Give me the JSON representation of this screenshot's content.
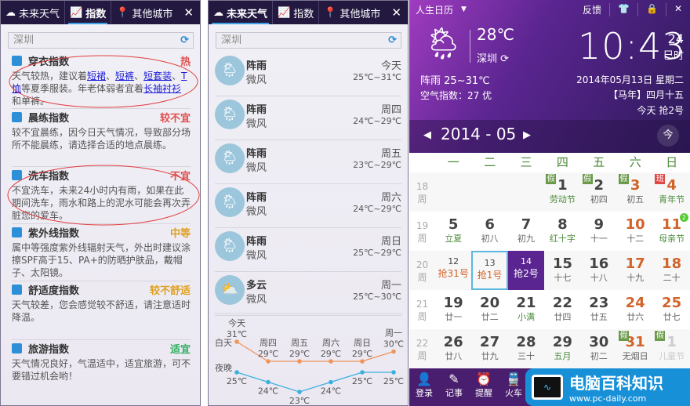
{
  "tabs": {
    "future": "未来天气",
    "index": "指数",
    "city": "其他城市"
  },
  "search": {
    "value": "深圳"
  },
  "indices": [
    {
      "title": "穿衣指数",
      "level": "热",
      "level_color": "#e05050",
      "icon": "shirt-icon",
      "desc_parts": [
        "天气较热，建议着",
        {
          "link": "短裙"
        },
        "、",
        {
          "link": "短裤"
        },
        "、",
        {
          "link": "短套装"
        },
        "、",
        {
          "link": "T恤"
        },
        "等夏季服装。年老体弱者宜着",
        {
          "link": "长袖衬衫"
        },
        "和单裤。"
      ]
    },
    {
      "title": "晨练指数",
      "level": "较不宜",
      "level_color": "#e05050",
      "icon": "exercise-icon",
      "desc": "较不宜晨练，因今日天气情况，导致部分场所不能晨练，请选择合适的地点晨练。"
    },
    {
      "title": "洗车指数",
      "level": "不宜",
      "level_color": "#e05050",
      "icon": "car-icon",
      "desc": "不宜洗车，未来24小时内有雨，如果在此期间洗车，雨水和路上的泥水可能会再次弄脏您的爱车。"
    },
    {
      "title": "紫外线指数",
      "level": "中等",
      "level_color": "#e0a020",
      "icon": "uv-icon",
      "desc": "属中等强度紫外线辐射天气，外出时建议涂擦SPF高于15、PA+的防晒护肤品，戴帽子、太阳镜。"
    },
    {
      "title": "舒适度指数",
      "level": "较不舒适",
      "level_color": "#e0a020",
      "icon": "smile-icon",
      "desc": "天气较差，您会感觉较不舒适，请注意适时降温。"
    },
    {
      "title": "旅游指数",
      "level": "适宜",
      "level_color": "#30b060",
      "icon": "plane-icon",
      "desc": "天气情况良好，气温适中，适宜旅游，可不要错过机会哟！"
    }
  ],
  "forecast": [
    {
      "day": "今天",
      "weather": "阵雨",
      "wind": "微风",
      "temp": "25℃~31℃"
    },
    {
      "day": "周四",
      "weather": "阵雨",
      "wind": "微风",
      "temp": "24℃~29℃"
    },
    {
      "day": "周五",
      "weather": "阵雨",
      "wind": "微风",
      "temp": "23℃~29℃"
    },
    {
      "day": "周六",
      "weather": "阵雨",
      "wind": "微风",
      "temp": "24℃~29℃"
    },
    {
      "day": "周日",
      "weather": "阵雨",
      "wind": "微风",
      "temp": "25℃~29℃"
    },
    {
      "day": "周一",
      "weather": "多云",
      "wind": "微风",
      "temp": "25℃~30℃"
    }
  ],
  "chart_data": {
    "type": "line",
    "categories": [
      "今天",
      "周四",
      "周五",
      "周六",
      "周日",
      "周一"
    ],
    "series": [
      {
        "name": "白天",
        "values": [
          31,
          29,
          29,
          29,
          29,
          30
        ],
        "color": "#f0945a"
      },
      {
        "name": "夜晚",
        "values": [
          25,
          24,
          23,
          24,
          25,
          25
        ],
        "color": "#3ab0e0"
      }
    ],
    "unit": "℃"
  },
  "calendar": {
    "app_title": "人生日历",
    "feedback": "反馈",
    "temp": "28℃",
    "city": "深圳",
    "weather": "阵雨 25~31℃",
    "air": "空气指数：27 优",
    "time": "10:43",
    "seconds": "24",
    "shichen": "巳时",
    "date": "2014年05月13日  星期二",
    "lunar": "【马年】四月十五",
    "today_note": "今天 抢2号",
    "year_month": "2014 - 05",
    "weekdays": [
      "一",
      "二",
      "三",
      "四",
      "五",
      "六",
      "日"
    ],
    "weeks": [
      {
        "w": "18",
        "days": [
          null,
          null,
          null,
          {
            "d": "1",
            "s": "劳动节",
            "b": "假",
            "sc": "#4a8a3a"
          },
          {
            "d": "2",
            "s": "初四",
            "b": "假"
          },
          {
            "d": "3",
            "s": "初五",
            "b": "假",
            "dc": "#d0642a"
          },
          {
            "d": "4",
            "s": "青年节",
            "b": "班",
            "bc": "#e04848",
            "dc": "#d0642a",
            "sc": "#4a8a3a"
          }
        ]
      },
      {
        "w": "19",
        "days": [
          {
            "d": "5",
            "s": "立夏",
            "sc": "#4a8a3a"
          },
          {
            "d": "6",
            "s": "初八"
          },
          {
            "d": "7",
            "s": "初九"
          },
          {
            "d": "8",
            "s": "红十字",
            "sc": "#4a8a3a"
          },
          {
            "d": "9",
            "s": "十一"
          },
          {
            "d": "10",
            "s": "十二",
            "dc": "#d0642a"
          },
          {
            "d": "11",
            "s": "母亲节",
            "dc": "#d0642a",
            "sc": "#4a8a3a",
            "note": "2"
          }
        ]
      },
      {
        "w": "20",
        "days": [
          {
            "d": "12",
            "s": "抢31号",
            "small": true,
            "sc": "#d0642a"
          },
          {
            "d": "13",
            "s": "抢1号",
            "small": true,
            "sc": "#d0642a",
            "today": true
          },
          {
            "d": "14",
            "s": "抢2号",
            "small": true,
            "sel": true
          },
          {
            "d": "15",
            "s": "十七"
          },
          {
            "d": "16",
            "s": "十八"
          },
          {
            "d": "17",
            "s": "十九",
            "dc": "#d0642a"
          },
          {
            "d": "18",
            "s": "二十",
            "dc": "#d0642a"
          }
        ]
      },
      {
        "w": "21",
        "days": [
          {
            "d": "19",
            "s": "廿一"
          },
          {
            "d": "20",
            "s": "廿二"
          },
          {
            "d": "21",
            "s": "小满",
            "sc": "#4a8a3a"
          },
          {
            "d": "22",
            "s": "廿四"
          },
          {
            "d": "23",
            "s": "廿五"
          },
          {
            "d": "24",
            "s": "廿六",
            "dc": "#d0642a"
          },
          {
            "d": "25",
            "s": "廿七",
            "dc": "#d0642a"
          }
        ]
      },
      {
        "w": "22",
        "days": [
          {
            "d": "26",
            "s": "廿八"
          },
          {
            "d": "27",
            "s": "廿九"
          },
          {
            "d": "28",
            "s": "三十"
          },
          {
            "d": "29",
            "s": "五月",
            "sc": "#4a8a3a"
          },
          {
            "d": "30",
            "s": "初二"
          },
          {
            "d": "31",
            "s": "无烟日",
            "b": "假",
            "dc": "#d0642a"
          },
          {
            "d": "1",
            "s": "儿童节",
            "b": "假",
            "dc": "#ccc",
            "sc": "#ccc"
          }
        ]
      }
    ],
    "week_suffix": "周",
    "bottom": [
      {
        "label": "登录",
        "icon": "user-icon",
        "g": "👤"
      },
      {
        "label": "记事",
        "icon": "note-icon",
        "g": "✎"
      },
      {
        "label": "提醒",
        "icon": "alarm-icon",
        "g": "⏰"
      },
      {
        "label": "火车",
        "icon": "train-icon",
        "g": "🚆"
      }
    ]
  },
  "watermark": {
    "title": "电脑百科知识",
    "url": "www.pc-daily.com"
  }
}
